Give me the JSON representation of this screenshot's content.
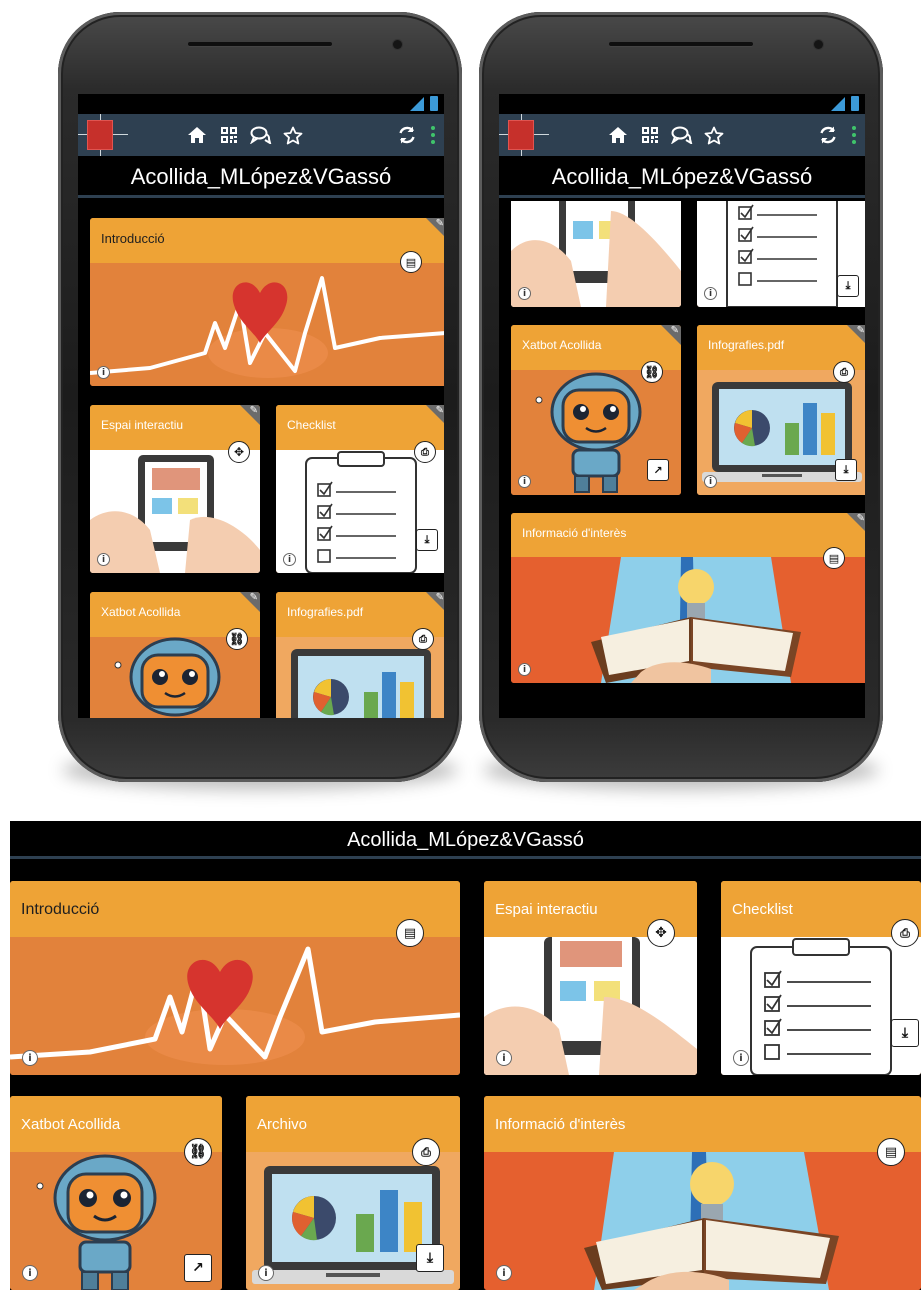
{
  "app": {
    "title": "Acollida_MLópez&VGassó"
  },
  "toolbar": {
    "icons": [
      "home-icon",
      "qr-code-icon",
      "chat-icon",
      "star-icon",
      "refresh-icon",
      "more-vert-icon"
    ]
  },
  "cards": {
    "introduccio": "Introducció",
    "espai": "Espai interactiu",
    "checklist": "Checklist",
    "xatbot": "Xatbot Acollida",
    "infografies": "Infografies.pdf",
    "informacio": "Informació d'interès",
    "archivo": "Archivo"
  },
  "colors": {
    "appbar": "#2e4051",
    "card_header": "#eea336",
    "card_body": "#e2823b",
    "info_card_body": "#e5602f",
    "accent_green": "#3fc46b"
  }
}
